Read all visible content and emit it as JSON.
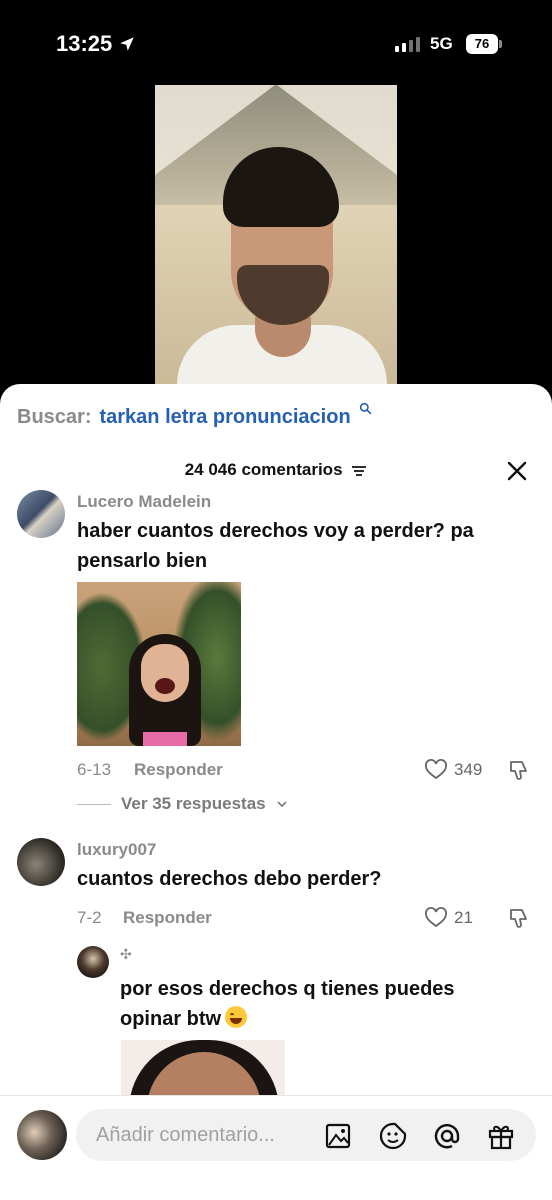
{
  "status_bar": {
    "time": "13:25",
    "network": "5G",
    "battery": "76"
  },
  "search": {
    "label": "Buscar:",
    "term": "tarkan letra pronunciacion"
  },
  "comments_header": {
    "count": "24 046 comentarios"
  },
  "comments": [
    {
      "username": "Lucero Madelein",
      "text": "haber cuantos derechos voy a perder? pa pensarlo bien",
      "date": "6-13",
      "reply_label": "Responder",
      "likes": "349",
      "view_replies": "Ver 35 respuestas"
    },
    {
      "username": "luxury007",
      "text": "cuantos derechos debo perder?",
      "date": "7-2",
      "reply_label": "Responder",
      "likes": "21"
    }
  ],
  "reply": {
    "username": "✣",
    "text": "por esos derechos q tienes puedes opinar btw"
  },
  "input": {
    "placeholder": "Añadir comentario..."
  },
  "colors": {
    "link": "#2660b5",
    "muted": "#8a8a8a",
    "text": "#111111"
  },
  "icons": [
    "location-arrow-icon",
    "search-icon",
    "filter-icon",
    "close-icon",
    "heart-icon",
    "dislike-icon",
    "chevron-down-icon",
    "image-icon",
    "sticker-icon",
    "at-icon",
    "gift-icon"
  ]
}
